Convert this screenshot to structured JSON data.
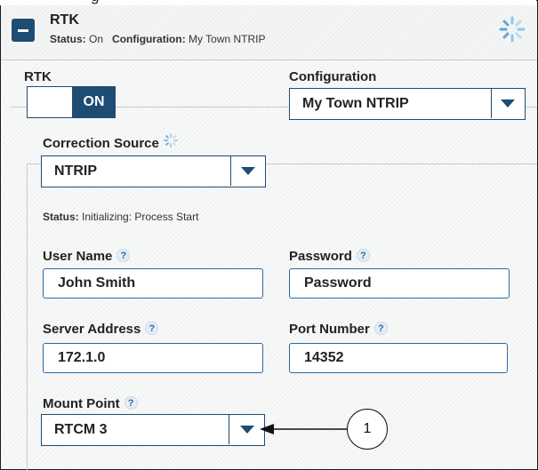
{
  "page_title_fragment": "g",
  "header": {
    "title": "RTK",
    "status_label": "Status:",
    "status_value": "On",
    "config_label": "Configuration:",
    "config_value": "My Town NTRIP"
  },
  "rtk": {
    "label": "RTK",
    "toggle_state": "ON"
  },
  "configuration": {
    "label": "Configuration",
    "selected": "My Town NTRIP"
  },
  "correction_source": {
    "label": "Correction Source",
    "selected": "NTRIP"
  },
  "status": {
    "label": "Status:",
    "value": "Initializing: Process Start"
  },
  "fields": {
    "user_name": {
      "label": "User Name",
      "value": "John Smith",
      "help": "?"
    },
    "password": {
      "label": "Password",
      "value": "Password",
      "help": "?"
    },
    "server_address": {
      "label": "Server Address",
      "value": "172.1.0",
      "help": "?"
    },
    "port_number": {
      "label": "Port Number",
      "value": "14352",
      "help": "?"
    }
  },
  "mount_point": {
    "label": "Mount Point",
    "selected": "RTCM 3",
    "help": "?"
  },
  "callout": {
    "number": "1"
  },
  "colors": {
    "accent": "#1e4c73",
    "spinner": "#8ec5e8",
    "input_border": "#2a6aa0"
  }
}
